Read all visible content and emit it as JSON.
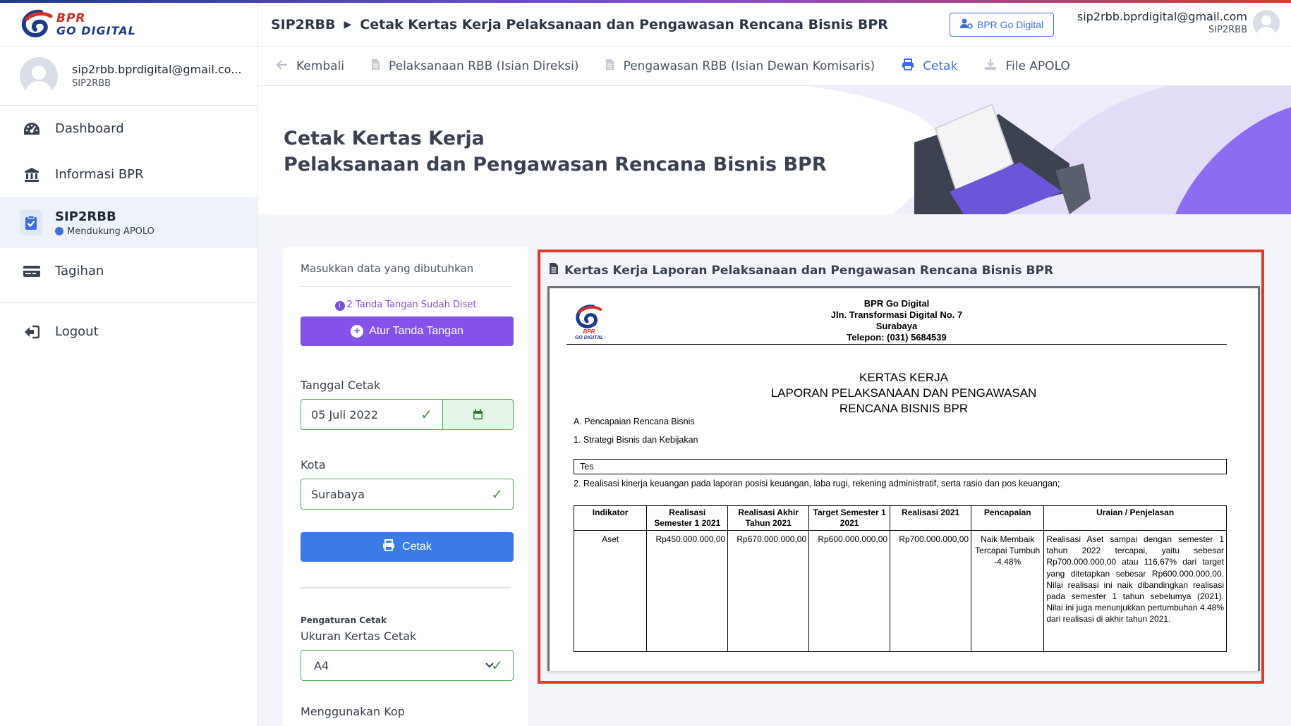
{
  "app": {
    "logo_line1": "BPR",
    "logo_line2": "GO DIGITAL"
  },
  "sidebar": {
    "user_email": "sip2rbb.bprdigital@gmail.co...",
    "user_role": "SIP2RBB",
    "items": [
      {
        "label": "Dashboard",
        "icon": "dashboard-icon"
      },
      {
        "label": "Informasi BPR",
        "icon": "bank-icon"
      },
      {
        "label": "SIP2RBB",
        "sub": "Mendukung APOLO",
        "icon": "clipboard-check-icon",
        "active": true
      },
      {
        "label": "Tagihan",
        "icon": "credit-card-icon"
      },
      {
        "label": "Logout",
        "icon": "logout-icon"
      }
    ]
  },
  "header": {
    "crumb_root": "SIP2RBB",
    "crumb_title": "Cetak Kertas Kerja Pelaksanaan dan Pengawasan Rencana Bisnis BPR",
    "bpr_button": "BPR Go Digital",
    "user_email": "sip2rbb.bprdigital@gmail.com",
    "user_role": "SIP2RBB"
  },
  "tabs": [
    {
      "label": "Kembali",
      "icon": "arrow-left-icon"
    },
    {
      "label": "Pelaksanaan RBB (Isian Direksi)",
      "icon": "file-icon"
    },
    {
      "label": "Pengawasan RBB (Isian Dewan Komisaris)",
      "icon": "file-icon"
    },
    {
      "label": "Cetak",
      "icon": "printer-icon",
      "active": true
    },
    {
      "label": "File APOLO",
      "icon": "download-icon"
    }
  ],
  "hero": {
    "line1": "Cetak Kertas Kerja",
    "line2": "Pelaksanaan dan Pengawasan Rencana Bisnis BPR"
  },
  "form": {
    "heading": "Masukkan data yang dibutuhkan",
    "signature_note": "2 Tanda Tangan Sudah Diset",
    "signature_button": "Atur Tanda Tangan",
    "date_label": "Tanggal Cetak",
    "date_value": "05 Juli 2022",
    "city_label": "Kota",
    "city_value": "Surabaya",
    "print_button": "Cetak",
    "settings_label": "Pengaturan Cetak",
    "paper_label": "Ukuran Kertas Cetak",
    "paper_value": "A4",
    "kop_label": "Menggunakan Kop"
  },
  "preview": {
    "title": "Kertas Kerja Laporan Pelaksanaan dan Pengawasan Rencana Bisnis BPR",
    "org_name": "BPR Go Digital",
    "org_address": "Jln. Transformasi Digital No. 7",
    "org_city": "Surabaya",
    "org_phone": "Telepon: (031) 5684539",
    "doc_title1": "KERTAS KERJA",
    "doc_title2": "LAPORAN PELAKSANAAN DAN PENGAWASAN",
    "doc_title3": "RENCANA BISNIS BPR",
    "section_a": "A. Pencapaian Rencana Bisnis",
    "item_1": "1. Strategi Bisnis dan Kebijakan",
    "item_1_value": "Tes",
    "item_2": "2. Realisasi kinerja keuangan pada laporan posisi keuangan, laba rugi, rekening administratif, serta rasio dan pos keuangan;",
    "table_headers": [
      "Indikator",
      "Realisasi Semester 1 2021",
      "Realisasi Akhir Tahun 2021",
      "Target Semester 1 2021",
      "Realisasi 2021",
      "Pencapaian",
      "Uraian / Penjelasan"
    ],
    "table_row": {
      "indikator": "Aset",
      "realisasi_sem1": "Rp450.000.000,00",
      "realisasi_akhir": "Rp670.000.000,00",
      "target_sem1": "Rp600.000.000,00",
      "realisasi_2021": "Rp700.000.000,00",
      "pencapaian": "Naik Membaik Tercapai Tumbuh -4.48%",
      "uraian": "Realisasi Aset sampai dengan semester 1 tahun 2022 tercapai, yaitu sebesar Rp700.000.000,00 atau 116,67% dari target yang ditetapkan sebesar Rp600.000.000,00. Nilai realisasi ini naik dibandingkan realisasi pada semester 1 tahun sebelumya (2021). Nilai ini juga menunjukkan pertumbuhan 4.48% dari realisasi di akhir tahun 2021."
    }
  },
  "colors": {
    "primary": "#3b7be8",
    "purple": "#8452e8",
    "success": "#4caf50",
    "highlight": "#e03a2a",
    "brand_red": "#d42f27",
    "brand_navy": "#1e3a8a"
  }
}
